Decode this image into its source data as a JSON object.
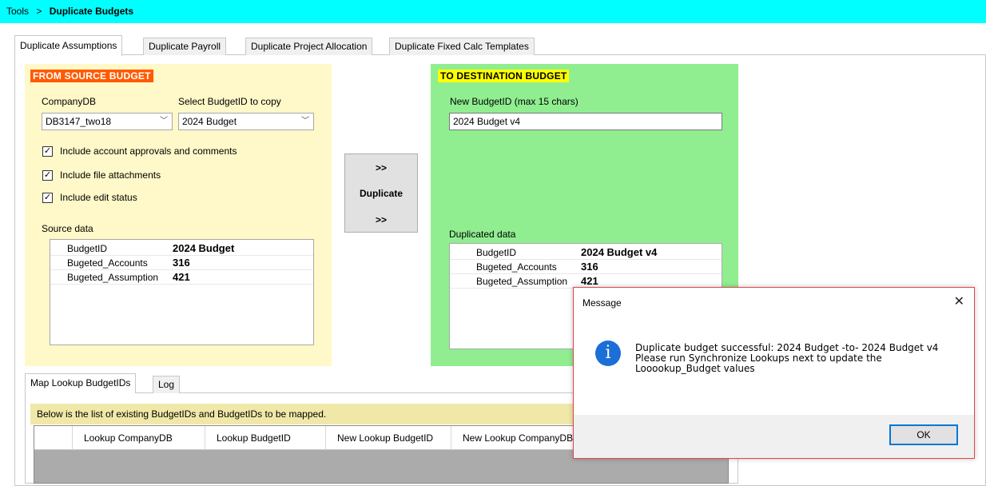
{
  "breadcrumb": {
    "root": "Tools",
    "separator": ">",
    "current": "Duplicate Budgets"
  },
  "tabs": [
    {
      "label": "Duplicate Assumptions",
      "active": true
    },
    {
      "label": "Duplicate Payroll",
      "active": false
    },
    {
      "label": "Duplicate Project Allocation",
      "active": false
    },
    {
      "label": "Duplicate Fixed Calc Templates",
      "active": false
    }
  ],
  "source": {
    "header": "FROM SOURCE BUDGET",
    "company_label": "CompanyDB",
    "company_value": "DB3147_two18",
    "budget_label": "Select BudgetID to copy",
    "budget_value": "2024 Budget",
    "options": [
      {
        "label": "Include account approvals and comments",
        "checked": true
      },
      {
        "label": "Include file attachments",
        "checked": true
      },
      {
        "label": "Include edit status",
        "checked": true
      }
    ],
    "data_label": "Source data",
    "rows": [
      {
        "key": "BudgetID",
        "value": "2024 Budget"
      },
      {
        "key": "Bugeted_Accounts",
        "value": "316"
      },
      {
        "key": "Bugeted_Assumption",
        "value": "421"
      }
    ]
  },
  "duplicate_button": {
    "top": ">>",
    "label": "Duplicate",
    "bottom": ">>"
  },
  "destination": {
    "header": "TO DESTINATION BUDGET",
    "new_id_label": "New BudgetID (max 15 chars)",
    "new_id_value": "2024 Budget v4",
    "data_label": "Duplicated data",
    "rows": [
      {
        "key": "BudgetID",
        "value": "2024 Budget v4"
      },
      {
        "key": "Bugeted_Accounts",
        "value": "316"
      },
      {
        "key": "Bugeted_Assumption",
        "value": "421"
      }
    ]
  },
  "bottom_tabs": [
    {
      "label": "Map Lookup BudgetIDs",
      "active": true
    },
    {
      "label": "Log",
      "active": false
    }
  ],
  "map_info": "Below is the list of existing BudgetIDs and BudgetIDs to be mapped.",
  "map_columns": [
    "Lookup CompanyDB",
    "Lookup BudgetID",
    "New Lookup BudgetID",
    "New Lookup CompanyDB"
  ],
  "dialog": {
    "title": "Message",
    "close_glyph": "✕",
    "icon": "info-icon",
    "line1": "Duplicate budget successful: 2024 Budget -to- 2024 Budget v4",
    "line2": "Please run Synchronize Lookups next to update the Looookup_Budget values",
    "ok_label": "OK"
  },
  "colors": {
    "header_bar": "#00ffff",
    "source_panel": "#fff8c8",
    "source_header": "#ff5a00",
    "destination_panel": "#90ee90",
    "destination_header": "#ffff00",
    "info_bar": "#f0e8a8",
    "dialog_border": "#e04848",
    "info_icon": "#1c6ed8"
  }
}
